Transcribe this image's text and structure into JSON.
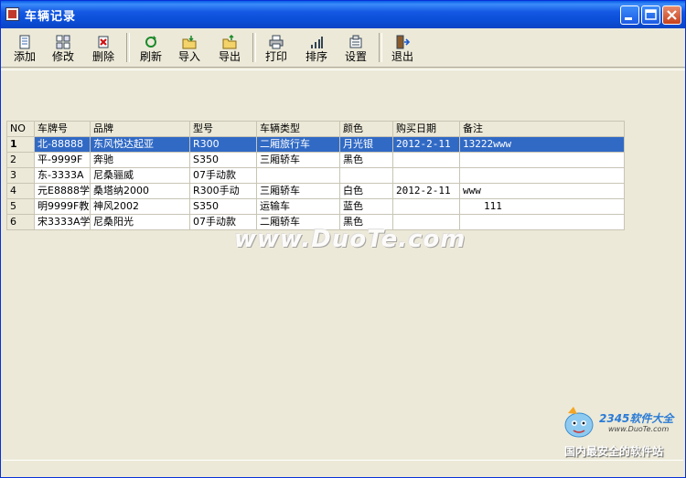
{
  "window": {
    "title": "车辆记录"
  },
  "toolbar": {
    "buttons": [
      {
        "label": "添加",
        "icon": "add-doc-icon"
      },
      {
        "label": "修改",
        "icon": "edit-grid-icon"
      },
      {
        "label": "删除",
        "icon": "delete-icon"
      },
      {
        "label": "刷新",
        "icon": "refresh-icon"
      },
      {
        "label": "导入",
        "icon": "import-folder-icon"
      },
      {
        "label": "导出",
        "icon": "export-folder-icon"
      },
      {
        "label": "打印",
        "icon": "printer-icon"
      },
      {
        "label": "排序",
        "icon": "sort-bars-icon"
      },
      {
        "label": "设置",
        "icon": "settings-icon"
      },
      {
        "label": "退出",
        "icon": "exit-door-icon"
      }
    ]
  },
  "grid": {
    "columns": [
      "NO",
      "车牌号",
      "品牌",
      "型号",
      "车辆类型",
      "颜色",
      "购买日期",
      "备注"
    ],
    "rows": [
      [
        "1",
        "北-88888",
        "东风悦达起亚",
        "R300",
        "二厢旅行车",
        "月光银",
        "2012-2-11",
        "13222www"
      ],
      [
        "2",
        "平-9999F",
        "奔驰",
        "S350",
        "三厢轿车",
        "黑色",
        "",
        ""
      ],
      [
        "3",
        "东-3333A",
        "尼桑骊威",
        "07手动款",
        "",
        "",
        "",
        ""
      ],
      [
        "4",
        "元E8888学",
        "桑塔纳2000",
        "R300手动",
        "三厢轿车",
        "白色",
        "2012-2-11",
        "www"
      ],
      [
        "5",
        "明9999F教",
        "神风2002",
        "S350",
        "运输车",
        "蓝色",
        "",
        "111"
      ],
      [
        "6",
        "宋3333A学",
        "尼桑阳光",
        "07手动款",
        "二厢轿车",
        "黑色",
        "",
        ""
      ]
    ],
    "selected_row": 0
  },
  "watermark": {
    "text": "www.DuoTe.com"
  },
  "logo": {
    "top": "2345软件大全",
    "url": "www.DuoTe.com",
    "bottom": "国内最安全的软件站"
  },
  "colors": {
    "titlebar": "#0b4fd8",
    "selection": "#316ac5",
    "window_bg": "#ece9d8"
  }
}
